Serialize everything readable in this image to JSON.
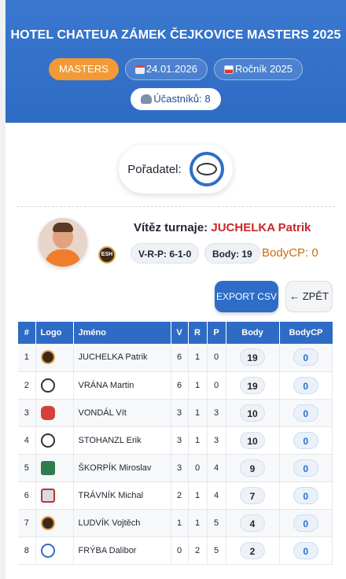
{
  "header": {
    "title": "HOTEL CHATEUA ZÁMEK ČEJKOVICE MASTERS 2025",
    "category": "MASTERS",
    "date": "24.01.2026",
    "season": "Ročník 2025",
    "participants": "Účastníků: 8"
  },
  "organizer": {
    "label": "Pořadatel:"
  },
  "winner": {
    "label": "Vítěz turnaje:",
    "name": "JUCHELKA Patrik",
    "vrp": "V-R-P: 6-1-0",
    "body": "Body: 19",
    "bodycp": "BodyCP: 0",
    "team_logo_text": "ESH"
  },
  "actions": {
    "export": "EXPORT CSV",
    "back": "← ZPĚT"
  },
  "table": {
    "headers": [
      "#",
      "Logo",
      "Jméno",
      "V",
      "R",
      "P",
      "Body",
      "BodyCP"
    ],
    "rows": [
      {
        "rank": "1",
        "logo": "esh",
        "name": "JUCHELKA Patrik",
        "v": "6",
        "r": "1",
        "p": "0",
        "body": "19",
        "bodycp": "0"
      },
      {
        "rank": "2",
        "logo": "owl",
        "name": "VRÁNA Martin",
        "v": "6",
        "r": "1",
        "p": "0",
        "body": "19",
        "bodycp": "0"
      },
      {
        "rank": "3",
        "logo": "mouth",
        "name": "VONDÁL Vít",
        "v": "3",
        "r": "1",
        "p": "3",
        "body": "10",
        "bodycp": "0"
      },
      {
        "rank": "4",
        "logo": "owl",
        "name": "STOHANZL Erik",
        "v": "3",
        "r": "1",
        "p": "3",
        "body": "10",
        "bodycp": "0"
      },
      {
        "rank": "5",
        "logo": "tree",
        "name": "ŠKORPÍK Miroslav",
        "v": "3",
        "r": "0",
        "p": "4",
        "body": "9",
        "bodycp": "0"
      },
      {
        "rank": "6",
        "logo": "cup",
        "name": "TRÁVNÍK Michal",
        "v": "2",
        "r": "1",
        "p": "4",
        "body": "7",
        "bodycp": "0"
      },
      {
        "rank": "7",
        "logo": "esh",
        "name": "LUDVÍK Vojtěch",
        "v": "1",
        "r": "1",
        "p": "5",
        "body": "4",
        "bodycp": "0"
      },
      {
        "rank": "8",
        "logo": "wing",
        "name": "FRÝBA Dalibor",
        "v": "0",
        "r": "2",
        "p": "5",
        "body": "2",
        "bodycp": "0"
      }
    ]
  }
}
